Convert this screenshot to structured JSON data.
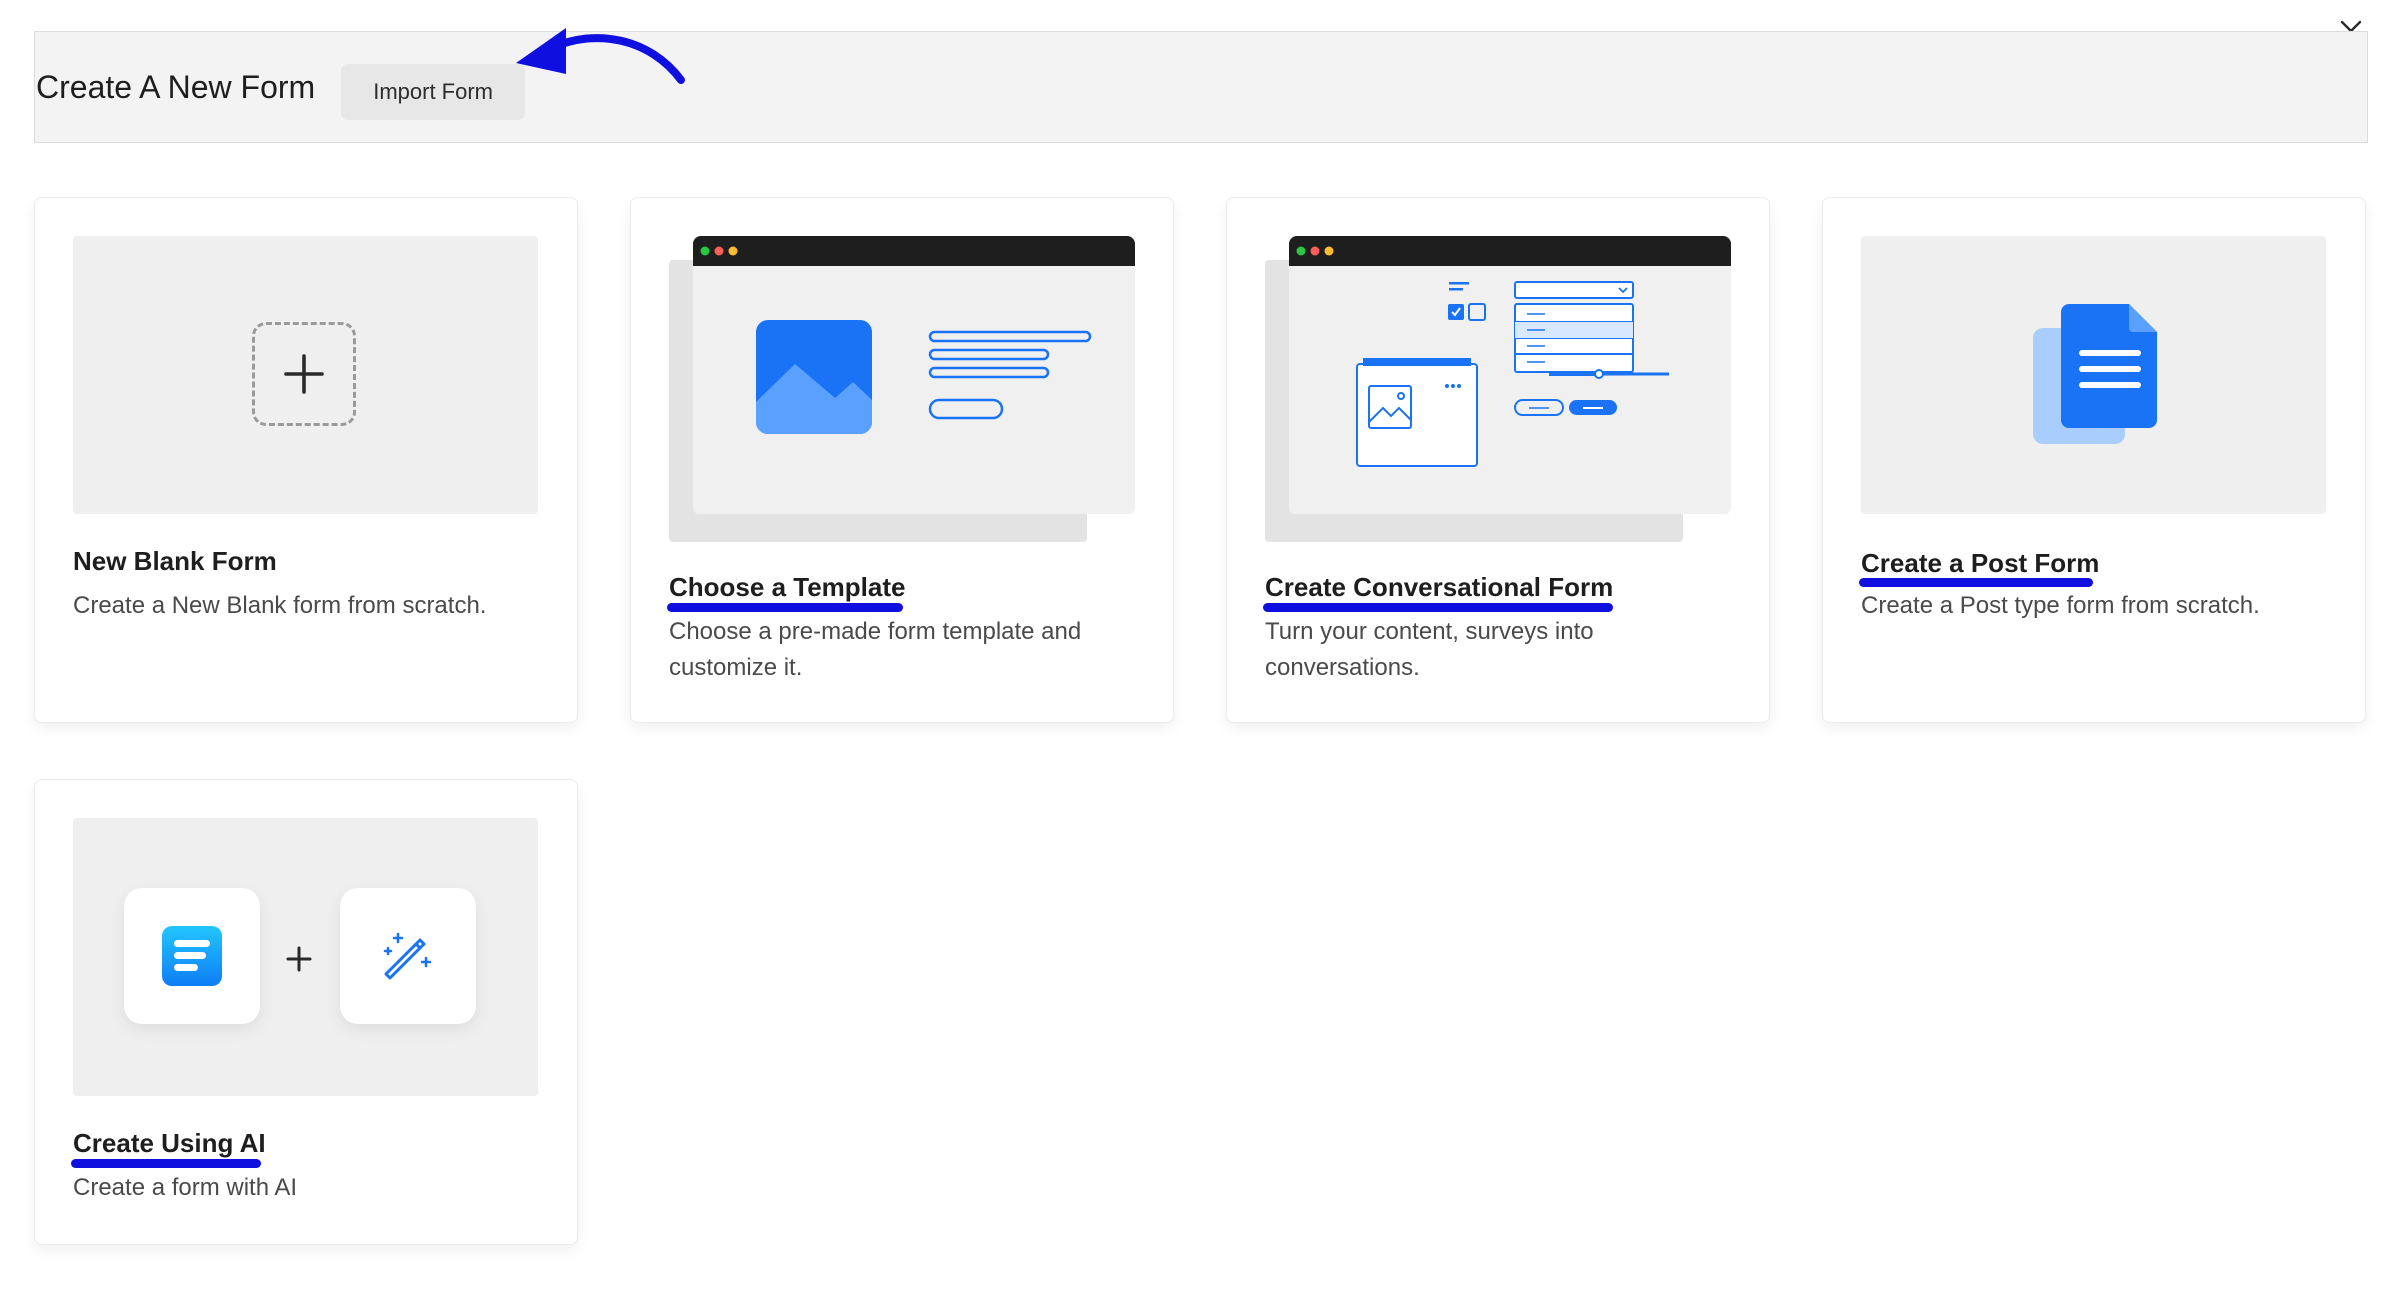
{
  "header": {
    "title": "Create A New Form",
    "import_label": "Import Form"
  },
  "cards": [
    {
      "title": "New Blank Form",
      "description": "Create a New Blank form from scratch."
    },
    {
      "title": "Choose a Template",
      "description": "Choose a pre-made form template and customize it."
    },
    {
      "title": "Create Conversational Form",
      "description": "Turn your content, surveys into conversations."
    },
    {
      "title": "Create a Post Form",
      "description": "Create a Post type form from scratch."
    },
    {
      "title": "Create Using AI",
      "description": "Create a form with AI"
    }
  ],
  "icons": {
    "close": "close-icon",
    "blank": "plus-icon",
    "template": "template-illustration",
    "conversational": "conversational-illustration",
    "post": "document-icon",
    "ai_left": "fluent-forms-logo-icon",
    "ai_right": "magic-wand-icon"
  },
  "colors": {
    "accent_blue": "#1a73f5",
    "annotation_blue": "#0f0fe0",
    "window_bar": "#1e1e1e"
  }
}
